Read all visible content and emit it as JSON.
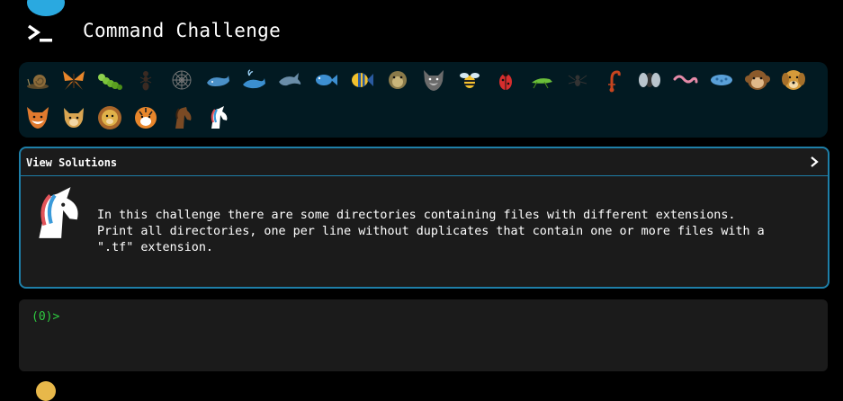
{
  "app": {
    "title": "Command Challenge",
    "accent_color": "#2aa9e0",
    "logo_icon": "terminal-prompt-icon"
  },
  "challenges": {
    "icons": [
      "snail-icon",
      "butterfly-icon",
      "caterpillar-icon",
      "ant-icon",
      "spider-web-icon",
      "whale-icon",
      "spouting-whale-icon",
      "dolphin-icon",
      "fish-icon",
      "tropical-fish-icon",
      "blowfish-icon",
      "wolf-icon",
      "bee-icon",
      "ladybug-icon",
      "cricket-icon",
      "spider-icon",
      "scorpion-icon",
      "fly-icon",
      "worm-icon",
      "microbe-icon",
      "monkey-icon",
      "dog-icon",
      "fox-icon",
      "cat-icon",
      "lion-icon",
      "tiger-icon",
      "horse-icon",
      "unicorn-icon"
    ],
    "active_icon": "unicorn-icon"
  },
  "solutions": {
    "label": "View Solutions",
    "toggle_icon": "chevron-right-icon",
    "avatar_icon": "unicorn-icon",
    "description": "In this challenge there are some directories containing files with different extensions.\nPrint all directories, one per line without duplicates that contain one or more files with a\n\".tf\" extension."
  },
  "terminal": {
    "prompt": "(0)>",
    "prompt_color": "#2ecc40",
    "input_value": ""
  }
}
